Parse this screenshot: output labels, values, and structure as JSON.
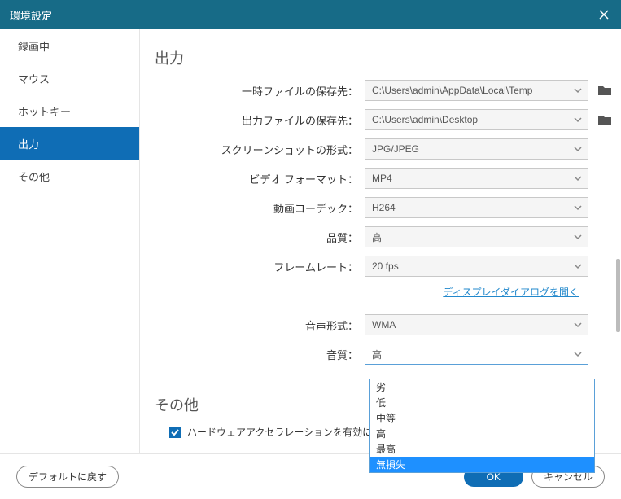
{
  "titlebar": {
    "title": "環境設定"
  },
  "sidebar": {
    "items": [
      {
        "label": "録画中"
      },
      {
        "label": "マウス"
      },
      {
        "label": "ホットキー"
      },
      {
        "label": "出力"
      },
      {
        "label": "その他"
      }
    ],
    "active_index": 3
  },
  "section1": {
    "heading": "出力",
    "rows": {
      "temp_path_label": "一時ファイルの保存先：",
      "temp_path_value": "C:\\Users\\admin\\AppData\\Local\\Temp",
      "output_path_label": "出力ファイルの保存先：",
      "output_path_value": "C:\\Users\\admin\\Desktop",
      "screenshot_fmt_label": "スクリーンショットの形式：",
      "screenshot_fmt_value": "JPG/JPEG",
      "video_fmt_label": "ビデオ フォーマット：",
      "video_fmt_value": "MP4",
      "codec_label": "動画コーデック：",
      "codec_value": "H264",
      "quality_label": "品質：",
      "quality_value": "高",
      "framerate_label": "フレームレート：",
      "framerate_value": "20 fps",
      "audio_fmt_label": "音声形式：",
      "audio_fmt_value": "WMA",
      "audio_quality_label": "音質：",
      "audio_quality_value": "高"
    },
    "link": "ディスプレイダイアログを開く"
  },
  "dropdown": {
    "options": [
      "劣",
      "低",
      "中等",
      "高",
      "最高",
      "無損失"
    ],
    "highlighted": "無損失"
  },
  "section2": {
    "heading": "その他",
    "checkbox_label": "ハードウェアアクセラレーションを有効にします"
  },
  "footer": {
    "default_btn": "デフォルトに戻す",
    "ok_btn": "OK",
    "cancel_btn": "キャンセル"
  }
}
